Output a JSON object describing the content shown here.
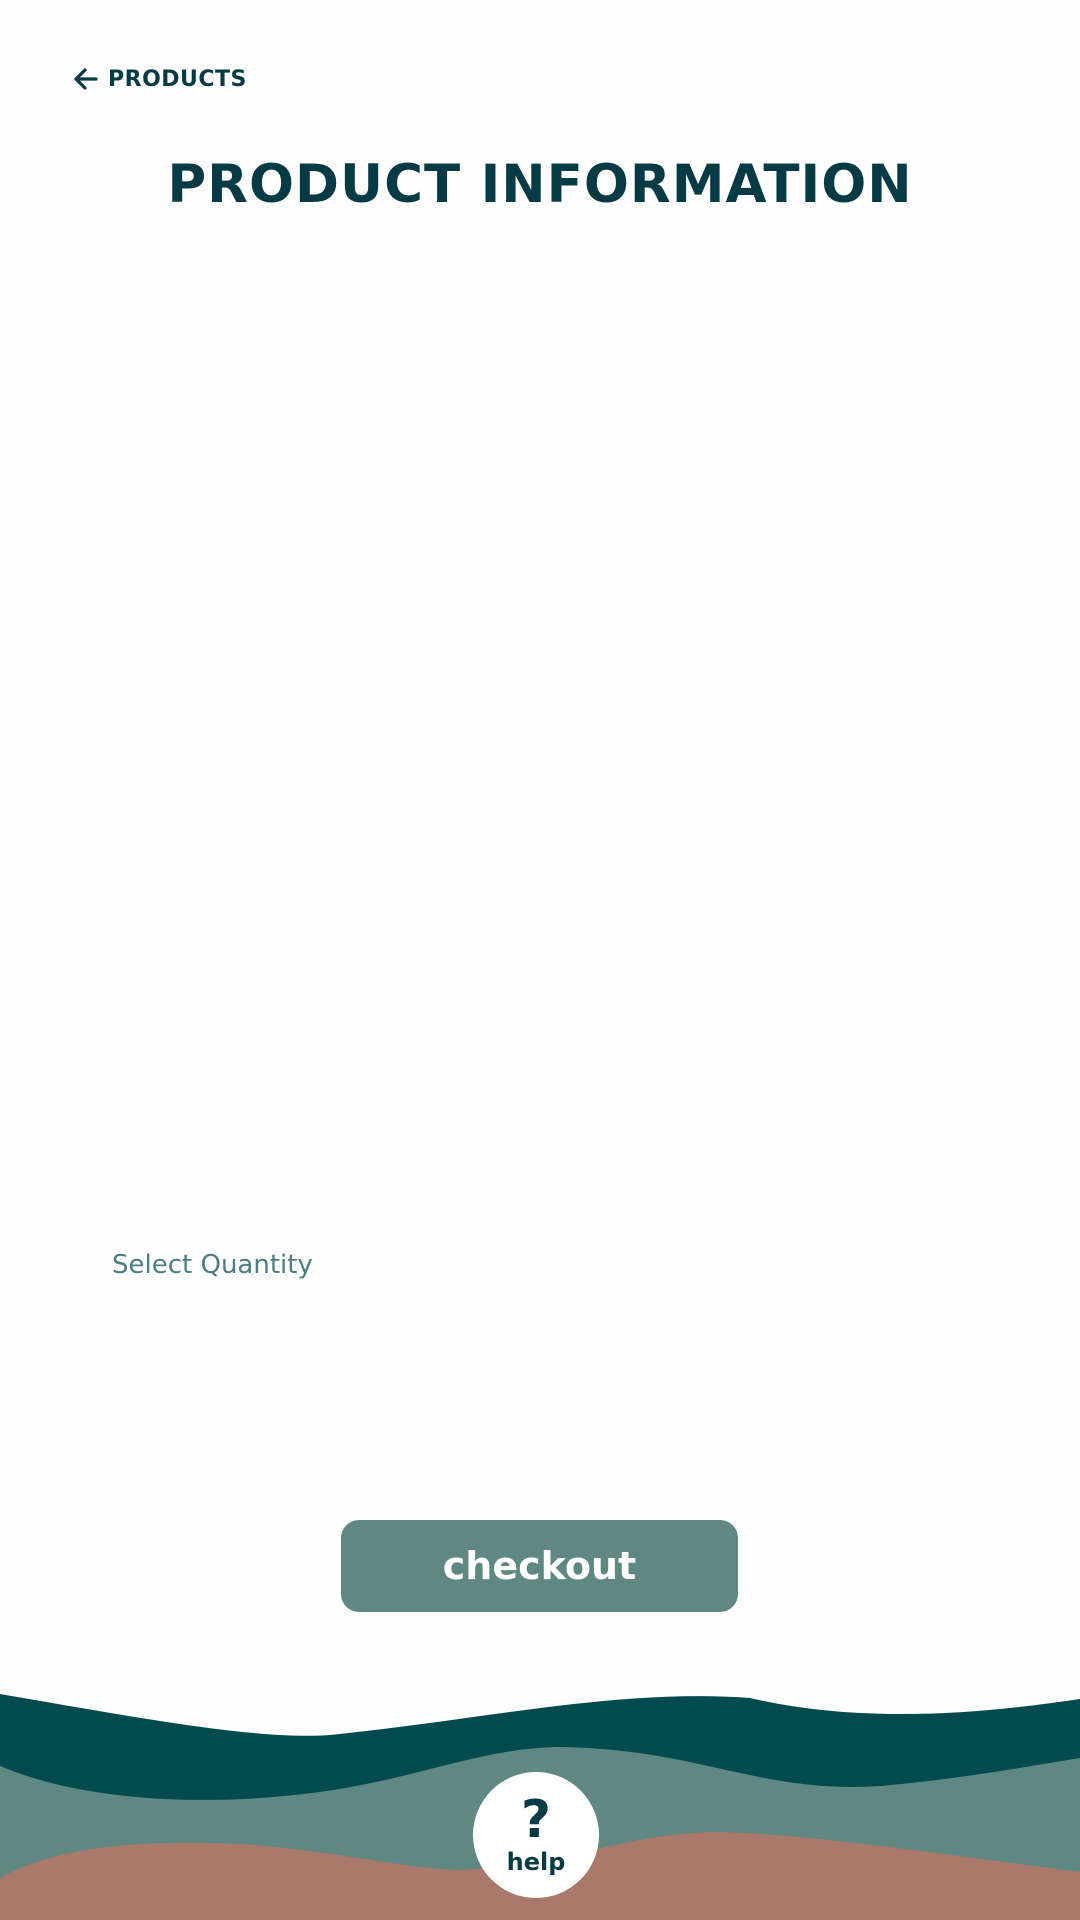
{
  "header": {
    "back_label": "PRODUCTS",
    "back_icon": "arrow-left-icon",
    "title": "PRODUCT INFORMATION"
  },
  "quantity": {
    "label": "Select Quantity"
  },
  "actions": {
    "checkout_label": "checkout"
  },
  "help": {
    "glyph": "?",
    "label": "help",
    "icon": "question-mark-icon"
  },
  "colors": {
    "primary_dark": "#063a45",
    "wave_dark": "#044b50",
    "wave_mid": "#5e8881",
    "wave_terracotta": "#a97a6b",
    "button_bg": "#5e8881",
    "quantity_label": "#4f7d84",
    "background": "#fdfdfd"
  }
}
